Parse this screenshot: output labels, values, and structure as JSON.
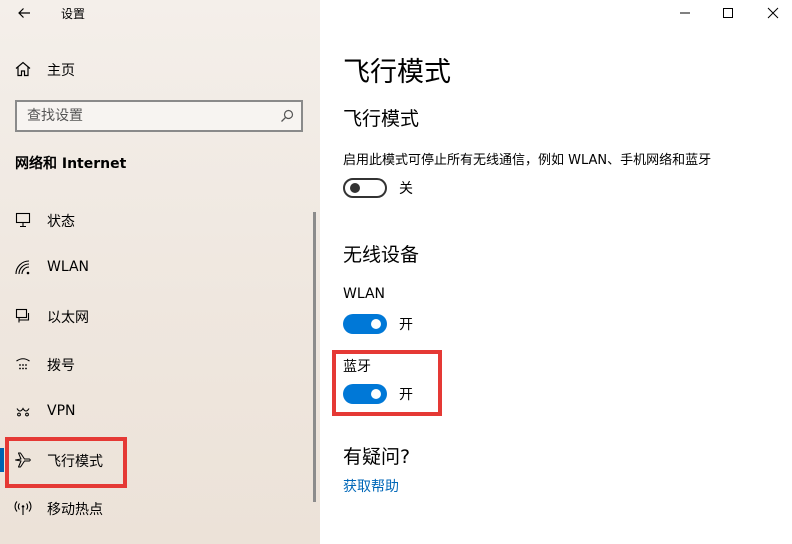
{
  "window": {
    "title": "设置",
    "controls": {
      "minimize_icon": "minimize-icon",
      "maximize_icon": "maximize-icon",
      "close_icon": "close-icon"
    }
  },
  "sidebar": {
    "home_label": "主页",
    "search": {
      "placeholder": "查找设置",
      "value": ""
    },
    "section_title": "网络和 Internet",
    "items": [
      {
        "label": "状态",
        "icon": "status-icon",
        "active": false
      },
      {
        "label": "WLAN",
        "icon": "wifi-icon",
        "active": false
      },
      {
        "label": "以太网",
        "icon": "ethernet-icon",
        "active": false
      },
      {
        "label": "拨号",
        "icon": "dialup-icon",
        "active": false
      },
      {
        "label": "VPN",
        "icon": "vpn-icon",
        "active": false
      },
      {
        "label": "飞行模式",
        "icon": "airplane-icon",
        "active": true
      },
      {
        "label": "移动热点",
        "icon": "hotspot-icon",
        "active": false
      }
    ]
  },
  "main": {
    "page_title": "飞行模式",
    "airplane": {
      "heading": "飞行模式",
      "description": "启用此模式可停止所有无线通信，例如 WLAN、手机网络和蓝牙",
      "toggle_state": "关",
      "toggle_on": false
    },
    "wireless": {
      "heading": "无线设备",
      "wlan": {
        "label": "WLAN",
        "state": "开",
        "on": true
      },
      "bluetooth": {
        "label": "蓝牙",
        "state": "开",
        "on": true
      }
    },
    "help": {
      "heading": "有疑问?",
      "link": "获取帮助"
    }
  },
  "colors": {
    "accent": "#0078d7",
    "link": "#0067b8",
    "highlight": "#e53935",
    "sidebar_bg": "#efe7df"
  }
}
